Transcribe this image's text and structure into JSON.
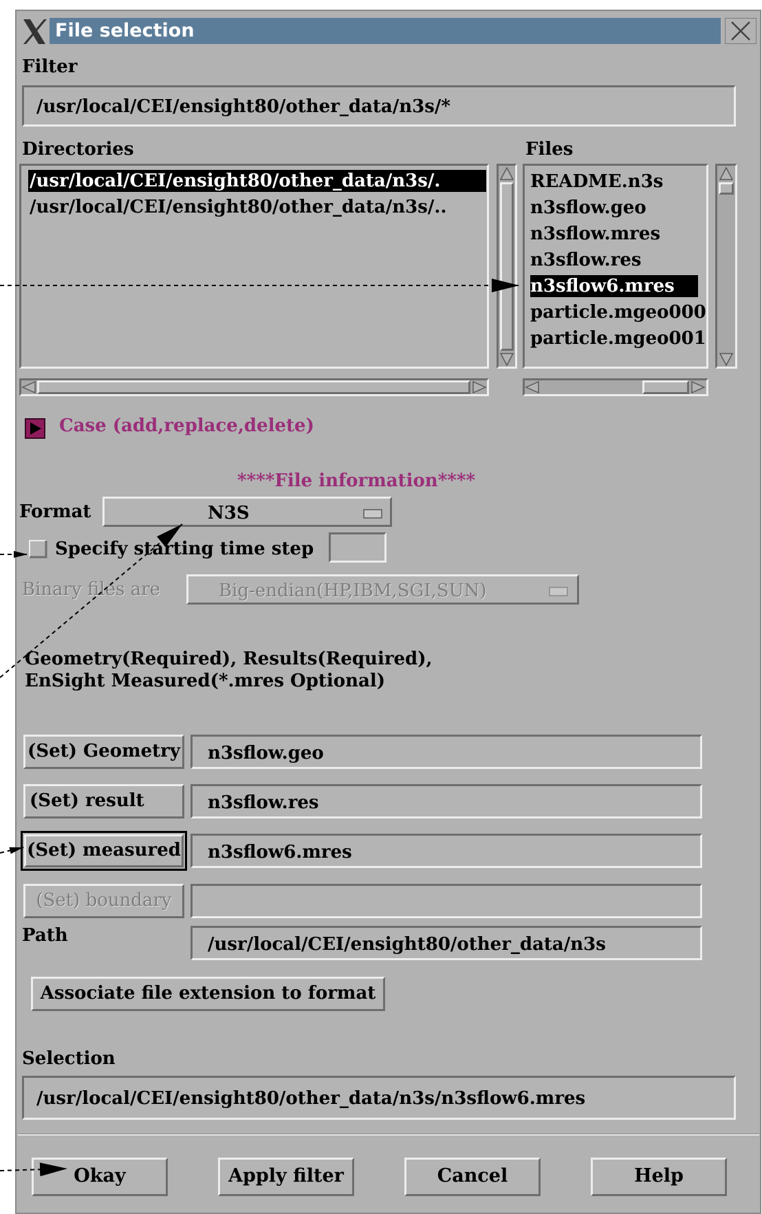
{
  "window": {
    "title": "File selection"
  },
  "filter": {
    "label": "Filter",
    "value": "/usr/local/CEI/ensight80/other_data/n3s/*"
  },
  "directories": {
    "label": "Directories",
    "items": [
      "/usr/local/CEI/ensight80/other_data/n3s/.",
      "/usr/local/CEI/ensight80/other_data/n3s/.."
    ],
    "selected_index": 0
  },
  "files": {
    "label": "Files",
    "items": [
      "README.n3s",
      "n3sflow.geo",
      "n3sflow.mres",
      "n3sflow.res",
      "n3sflow6.mres",
      "particle.mgeo000",
      "particle.mgeo001"
    ],
    "selected_index": 4
  },
  "case_toggle": {
    "label": "Case (add,replace,delete)"
  },
  "file_info": {
    "heading": "****File information****",
    "format_label": "Format",
    "format_value": "N3S",
    "specify_time_step_label": "Specify starting time step",
    "specify_time_step_value": "",
    "binary_label": "Binary files are",
    "binary_value": "Big-endian(HP,IBM,SGI,SUN)",
    "requirements_line1": "Geometry(Required), Results(Required),",
    "requirements_line2": "EnSight Measured(*.mres Optional)"
  },
  "set_rows": [
    {
      "button": "(Set) Geometry",
      "value": "n3sflow.geo"
    },
    {
      "button": "(Set) result",
      "value": "n3sflow.res"
    },
    {
      "button": "(Set) measured",
      "value": "n3sflow6.mres"
    },
    {
      "button": "(Set) boundary",
      "value": ""
    }
  ],
  "path": {
    "label": "Path",
    "value": "/usr/local/CEI/ensight80/other_data/n3s"
  },
  "associate_button": "Associate file extension to format",
  "selection": {
    "label": "Selection",
    "value": "/usr/local/CEI/ensight80/other_data/n3s/n3sflow6.mres"
  },
  "buttons": {
    "okay": "Okay",
    "apply_filter": "Apply filter",
    "cancel": "Cancel",
    "help": "Help"
  },
  "colors": {
    "title_bar": "#5c7d9a",
    "panel": "#b2b2b2",
    "selection_bg": "#000000",
    "accent_text": "#9b2f7a"
  }
}
